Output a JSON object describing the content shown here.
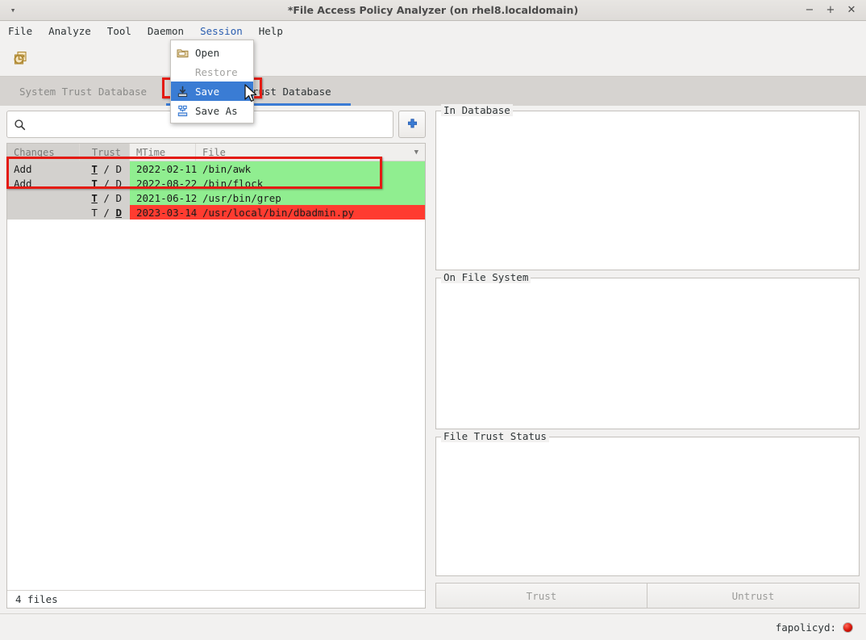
{
  "window": {
    "title": "*File Access Policy Analyzer (on rhel8.localdomain)",
    "menu_arrow": "▾",
    "minimize": "−",
    "maximize": "+",
    "close": "✕"
  },
  "menubar": {
    "items": [
      {
        "label": "File",
        "active": false
      },
      {
        "label": "Analyze",
        "active": false
      },
      {
        "label": "Tool",
        "active": false
      },
      {
        "label": "Daemon",
        "active": false
      },
      {
        "label": "Session",
        "active": true
      },
      {
        "label": "Help",
        "active": false
      }
    ]
  },
  "dropdown": {
    "open_menu": "Session",
    "items": [
      {
        "label": "Open",
        "icon": "folder-icon",
        "state": "normal"
      },
      {
        "label": "Restore",
        "icon": "none",
        "state": "disabled"
      },
      {
        "label": "Save",
        "icon": "save-icon",
        "state": "selected"
      },
      {
        "label": "Save As",
        "icon": "save-as-icon",
        "state": "normal"
      }
    ]
  },
  "toolbar": {
    "refresh_label": "refresh-databases-icon"
  },
  "tabs": [
    {
      "label": "System Trust Database",
      "active": false
    },
    {
      "label": "Ancillary Trust Database",
      "active": true
    }
  ],
  "search": {
    "value": "",
    "placeholder": "",
    "icon": "search-icon",
    "add_button_label": "+"
  },
  "table": {
    "columns": [
      "Changes",
      "Trust",
      "MTime",
      "File"
    ],
    "sort_caret": "▼",
    "rows": [
      {
        "changes": "Add",
        "trust_t": "T",
        "trust_sep": " / ",
        "trust_d": "D",
        "trust_marked": "T",
        "mtime": "2022-02-11",
        "file": "/bin/awk",
        "highlight": "green"
      },
      {
        "changes": "Add",
        "trust_t": "T",
        "trust_sep": " / ",
        "trust_d": "D",
        "trust_marked": "T",
        "mtime": "2022-08-22",
        "file": "/bin/flock",
        "highlight": "green"
      },
      {
        "changes": "",
        "trust_t": "T",
        "trust_sep": " / ",
        "trust_d": "D",
        "trust_marked": "T",
        "mtime": "2021-06-12",
        "file": "/usr/bin/grep",
        "highlight": "green"
      },
      {
        "changes": "",
        "trust_t": "T",
        "trust_sep": " / ",
        "trust_d": "D",
        "trust_marked": "D",
        "mtime": "2023-03-14",
        "file": "/usr/local/bin/dbadmin.py",
        "highlight": "red"
      }
    ],
    "status": "4 files"
  },
  "details": {
    "groups": [
      {
        "label": "In Database",
        "content": ""
      },
      {
        "label": "On File System",
        "content": ""
      },
      {
        "label": "File Trust Status",
        "content": ""
      }
    ],
    "buttons": [
      {
        "label": "Trust",
        "enabled": false
      },
      {
        "label": "Untrust",
        "enabled": false
      }
    ]
  },
  "statusbar": {
    "daemon_label": "fapolicyd:",
    "daemon_state": "stopped",
    "daemon_color": "#d81408"
  },
  "colors": {
    "accent_blue": "#3b7bd4",
    "row_green": "#90ee90",
    "row_red": "#ff3b30",
    "annotation_red": "#e41b13",
    "cell_grey": "#d3d1ce"
  }
}
